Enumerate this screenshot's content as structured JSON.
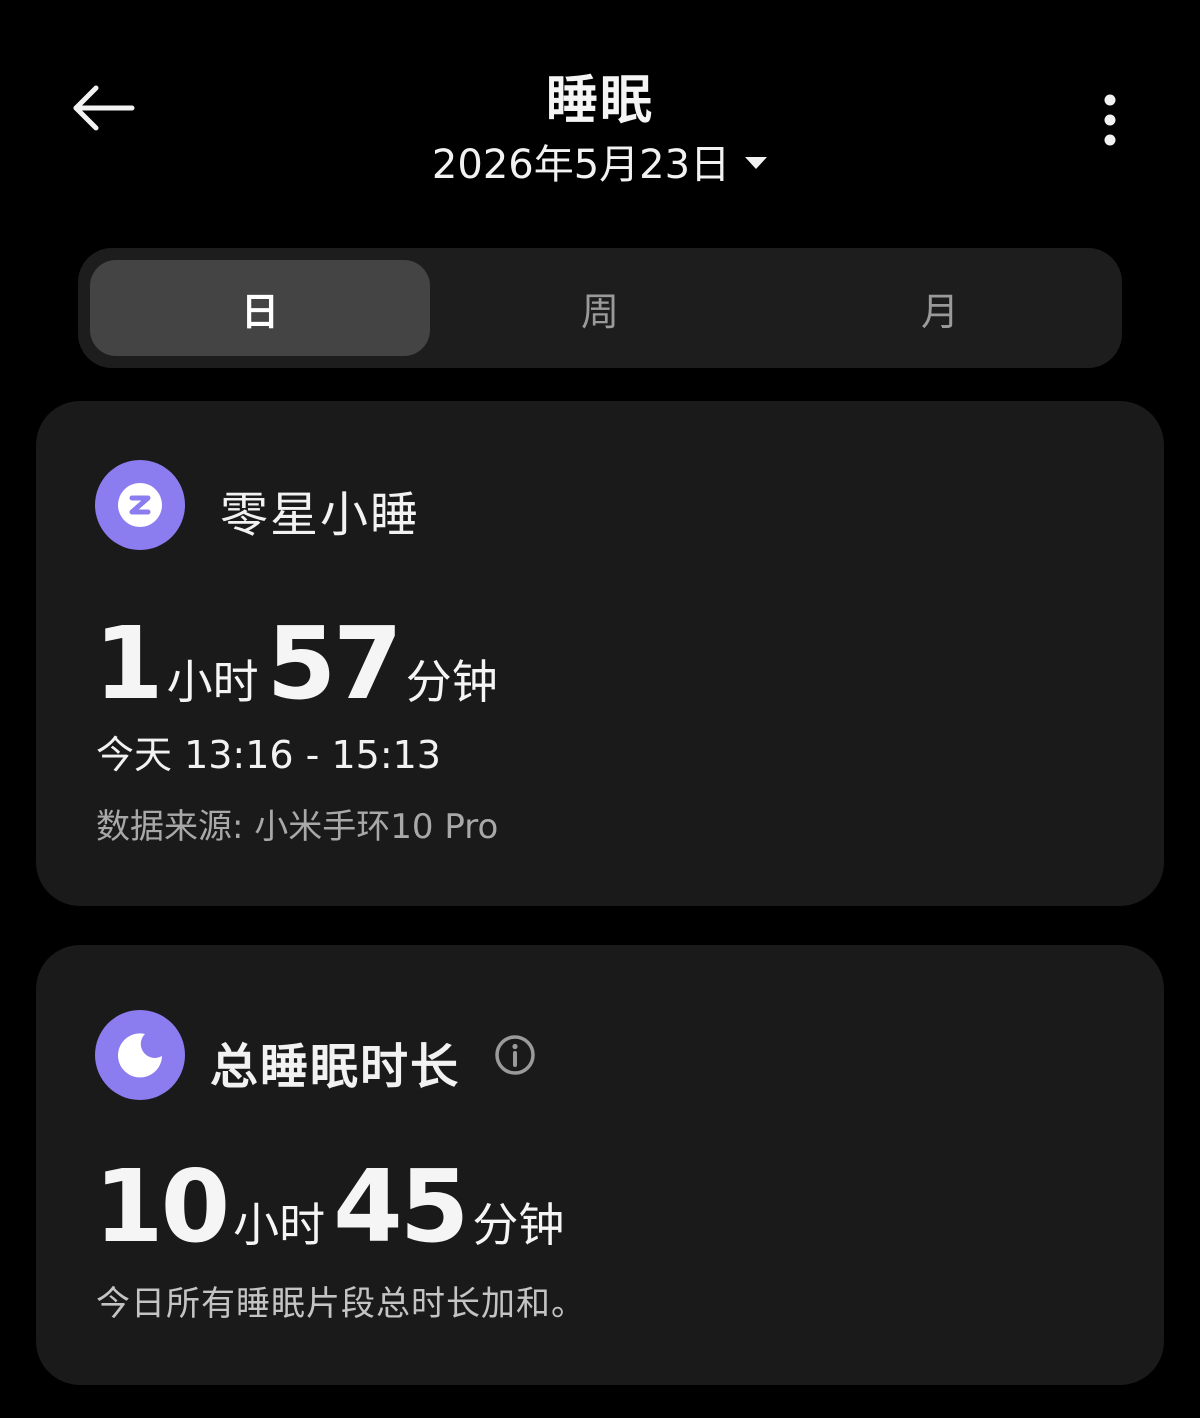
{
  "header": {
    "title": "睡眠",
    "date": "2026年5月23日"
  },
  "tabs": [
    {
      "label": "日",
      "active": true
    },
    {
      "label": "周",
      "active": false
    },
    {
      "label": "月",
      "active": false
    }
  ],
  "nap_card": {
    "title": "零星小睡",
    "hours": "1",
    "hours_unit": "小时",
    "minutes": "57",
    "minutes_unit": "分钟",
    "time_range": "今天 13:16 - 15:13",
    "source": "数据来源: 小米手环10 Pro",
    "icon": "nap-z-icon"
  },
  "total_card": {
    "title": "总睡眠时长",
    "hours": "10",
    "hours_unit": "小时",
    "minutes": "45",
    "minutes_unit": "分钟",
    "description": "今日所有睡眠片段总时长加和。",
    "icon": "moon-icon"
  },
  "colors": {
    "background": "#000000",
    "card": "#1a1a1a",
    "accent": "#8b7cf0",
    "tab_active": "#444444"
  }
}
